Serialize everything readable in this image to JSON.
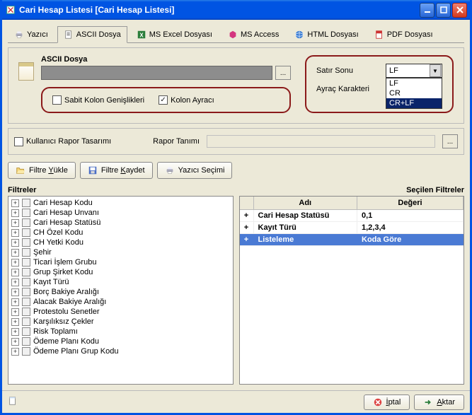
{
  "titlebar": {
    "text": "Cari Hesap Listesi [Cari Hesap Listesi]"
  },
  "tabs": {
    "yazici": "Yazıcı",
    "ascii": "ASCII Dosya",
    "excel": "MS Excel Dosyası",
    "access": "MS Access",
    "html": "HTML Dosyası",
    "pdf": "PDF Dosyası"
  },
  "export": {
    "ascii_label": "ASCII Dosya",
    "fixed_width": "Sabit Kolon Genişlikleri",
    "column_sep": "Kolon Ayracı",
    "line_end_label": "Satır Sonu",
    "sep_char_label": "Ayraç Karakteri",
    "line_end_value": "LF",
    "options": [
      "LF",
      "CR",
      "CR+LF"
    ]
  },
  "report": {
    "user_design": "Kullanıcı Rapor Tasarımı",
    "def_label": "Rapor Tanımı"
  },
  "toolbar": {
    "load": "Filtre ",
    "load_u": "Y",
    "load_rest": "ükle",
    "save": "Filtre ",
    "save_u": "K",
    "save_rest": "aydet",
    "printer": "Yazıcı Seçimi"
  },
  "filters": {
    "left_header": "Filtreler",
    "right_header": "Seçilen Filtreler",
    "items": [
      "Cari Hesap Kodu",
      "Cari Hesap Unvanı",
      "Cari Hesap Statüsü",
      "CH Özel Kodu",
      "CH Yetki Kodu",
      "Şehir",
      "Ticari İşlem Grubu",
      "Grup Şirket Kodu",
      "Kayıt Türü",
      "Borç Bakiye Aralığı",
      "Alacak Bakiye Aralığı",
      "Protestolu Senetler",
      "Karşılıksız Çekler",
      "Risk Toplamı",
      "Ödeme Planı Kodu",
      "Ödeme Planı Grup Kodu"
    ]
  },
  "selected": {
    "col_name": "Adı",
    "col_val": "Değeri",
    "rows": [
      {
        "name": "Cari Hesap Statüsü",
        "value": "0,1"
      },
      {
        "name": "Kayıt Türü",
        "value": "1,2,3,4"
      },
      {
        "name": "Listeleme",
        "value": "Koda Göre"
      }
    ]
  },
  "footer": {
    "cancel": "İptal",
    "transfer": "Aktar"
  }
}
